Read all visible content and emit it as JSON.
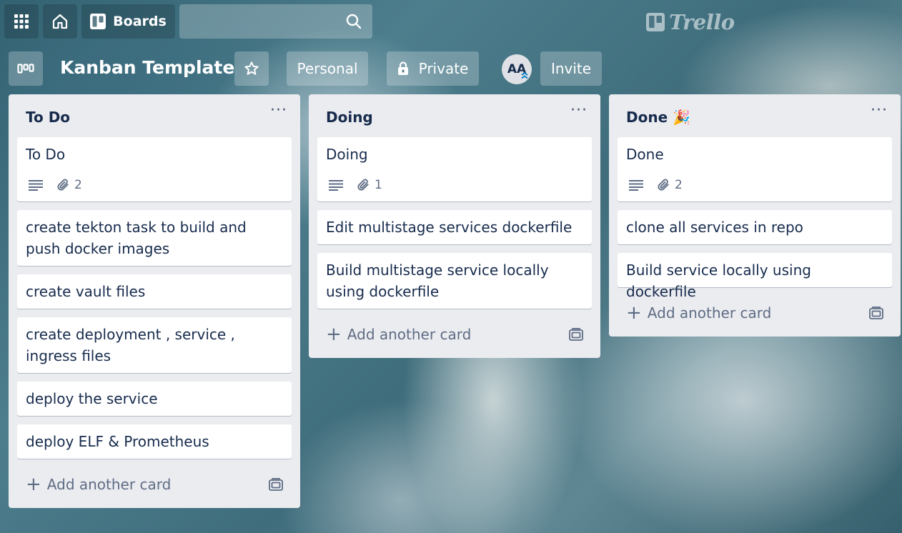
{
  "header": {
    "boards_label": "Boards",
    "search_placeholder": "",
    "logo_text": "Trello"
  },
  "board": {
    "title": "Kanban Template",
    "visibility_team": "Personal",
    "visibility_privacy": "Private",
    "member_initials": "AA",
    "invite_label": "Invite"
  },
  "lists": [
    {
      "title": "To Do",
      "cards": [
        {
          "text": "To Do",
          "attachments": "2"
        },
        {
          "text": "create tekton task to build and push docker images"
        },
        {
          "text": "create vault files"
        },
        {
          "text": "create deployment , service , ingress files"
        },
        {
          "text": "deploy the service"
        },
        {
          "text": "deploy ELF & Prometheus"
        }
      ],
      "add_card": "Add another card"
    },
    {
      "title": "Doing",
      "cards": [
        {
          "text": "Doing",
          "attachments": "1"
        },
        {
          "text": "Edit multistage services dockerfile"
        },
        {
          "text": "Build multistage service locally using dockerfile"
        }
      ],
      "add_card": "Add another card"
    },
    {
      "title": "Done 🎉",
      "cards": [
        {
          "text": "Done",
          "attachments": "2"
        },
        {
          "text": "clone all services in repo"
        },
        {
          "text": "Build service locally using dockerfile"
        }
      ],
      "add_card": "Add another card"
    }
  ],
  "icons": {
    "apps": "grid-icon",
    "home": "home-icon",
    "boards": "board-icon",
    "search": "search-icon",
    "star": "star-icon",
    "lock": "lock-icon",
    "description": "description-icon",
    "attachment": "paperclip-icon",
    "template": "card-template-icon"
  }
}
